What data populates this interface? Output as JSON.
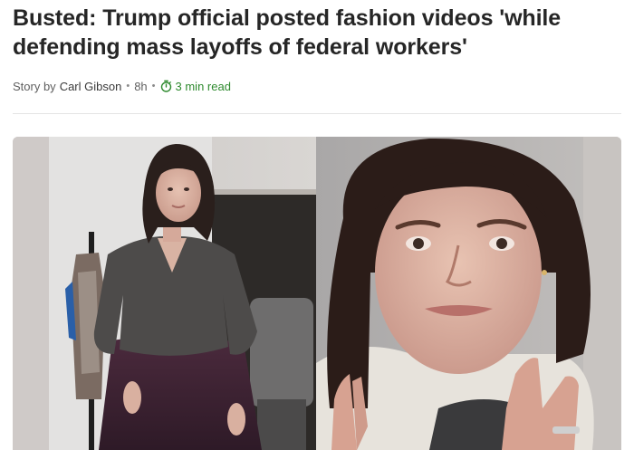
{
  "article": {
    "headline": "Busted: Trump official posted fashion videos 'while defending mass layoffs of federal workers'",
    "byline": {
      "story_by": "Story by",
      "author": "Carl Gibson",
      "separator": "•",
      "age": "8h",
      "read_time": "3 min read",
      "read_icon": "stopwatch-icon"
    },
    "image": {
      "left_panel": "woman-standing-in-office-photo",
      "right_panel": "woman-waving-selfie-photo"
    }
  },
  "colors": {
    "headline": "#262626",
    "byline_text": "#5f5f5f",
    "read_time": "#2e8a2e",
    "divider": "#e4e4e4"
  }
}
